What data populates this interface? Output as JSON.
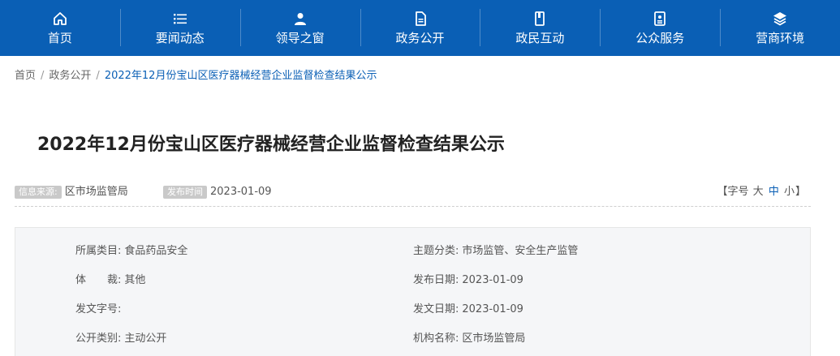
{
  "nav": {
    "items": [
      {
        "label": "首页",
        "icon": "home-icon"
      },
      {
        "label": "要闻动态",
        "icon": "list-icon"
      },
      {
        "label": "领导之窗",
        "icon": "user-icon"
      },
      {
        "label": "政务公开",
        "icon": "document-icon"
      },
      {
        "label": "政民互动",
        "icon": "book-icon"
      },
      {
        "label": "公众服务",
        "icon": "service-icon"
      },
      {
        "label": "营商环境",
        "icon": "layers-icon"
      }
    ]
  },
  "breadcrumb": {
    "items": [
      "首页",
      "政务公开"
    ],
    "current": "2022年12月份宝山区医疗器械经营企业监督检查结果公示"
  },
  "article": {
    "title": "2022年12月份宝山区医疗器械经营企业监督检查结果公示",
    "source_tag": "信息来源:",
    "source": "区市场监管局",
    "date_tag": "发布时间",
    "date": "2023-01-09",
    "fontsize": {
      "open": "【字号",
      "large": "大",
      "medium": "中",
      "small": "小",
      "close": "】"
    }
  },
  "info": {
    "category_key": "所属类目:",
    "category_val": "食品药品安全",
    "topic_key": "主题分类:",
    "topic_val": "市场监管、安全生产监管",
    "genre_key": "体　　裁:",
    "genre_val": "其他",
    "pubdate_key": "发布日期:",
    "pubdate_val": "2023-01-09",
    "docno_key": "发文字号:",
    "docno_val": "",
    "docdate_key": "发文日期:",
    "docdate_val": "2023-01-09",
    "open_key": "公开类别:",
    "open_val": "主动公开",
    "org_key": "机构名称:",
    "org_val": "区市场监管局"
  },
  "colors": {
    "nav_bg": "#0a5fb5",
    "link": "#0a5fb5",
    "tag_bg": "#c9c9c9",
    "info_bg": "#f5f6f8"
  }
}
